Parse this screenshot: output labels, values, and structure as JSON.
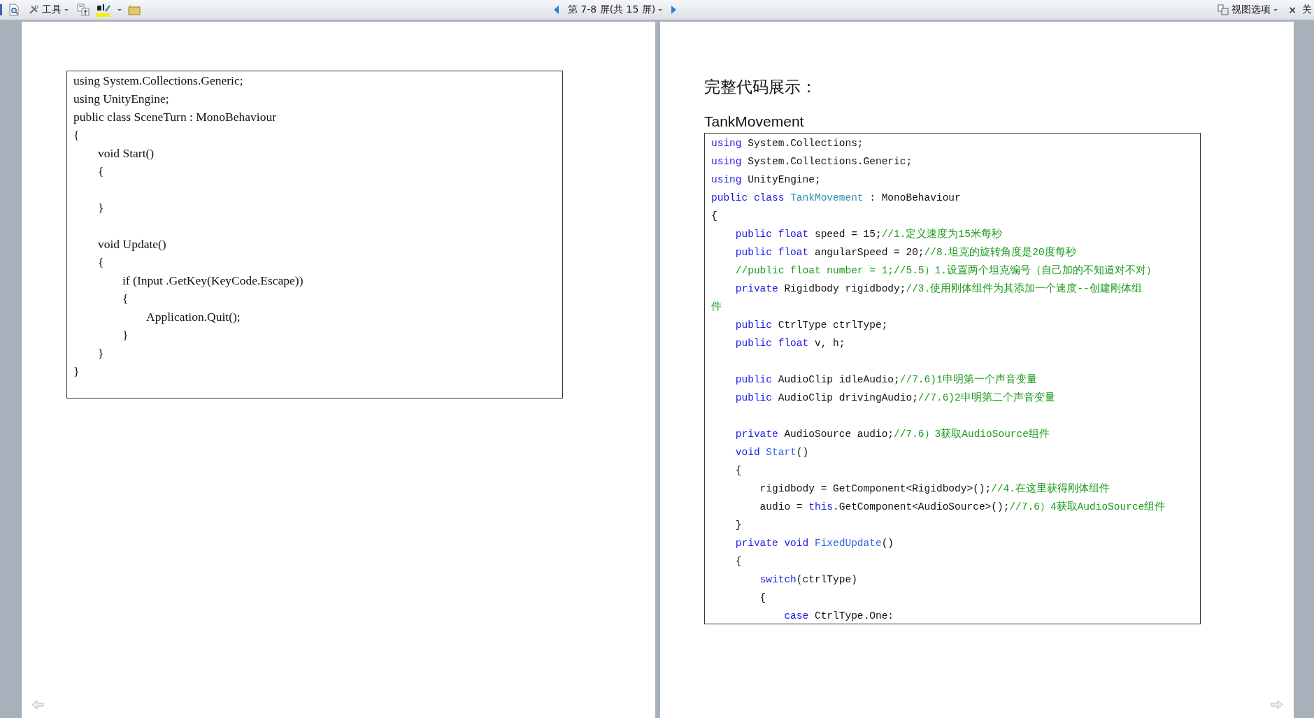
{
  "toolbar": {
    "tools_menu": {
      "label": "工具"
    },
    "page_indicator": {
      "label": "第 7-8 屏(共 15 屏)"
    },
    "view_options": {
      "label": "视图选项"
    },
    "close": {
      "symbol": "×",
      "label": "关"
    }
  },
  "pages": [
    {
      "code": {
        "kind": "plain",
        "lines": [
          {
            "text": "using System.Collections.Generic;"
          },
          {
            "text": "using UnityEngine;"
          },
          {
            "text": "public class SceneTurn : MonoBehaviour"
          },
          {
            "text": "{"
          },
          {
            "text": "        void Start()"
          },
          {
            "text": "        {"
          },
          {
            "kind": "blank"
          },
          {
            "text": "        }"
          },
          {
            "kind": "blank"
          },
          {
            "text": "        void Update()"
          },
          {
            "text": "        {"
          },
          {
            "text": "                if (Input .GetKey(KeyCode.Escape))"
          },
          {
            "text": "                {"
          },
          {
            "text": "                        Application.Quit();"
          },
          {
            "text": "                }"
          },
          {
            "text": "        }"
          },
          {
            "text": "}"
          }
        ]
      }
    },
    {
      "heading": "完整代码展示：",
      "subheading": "TankMovement",
      "code": {
        "kind": "highlighted",
        "lines": [
          {
            "tokens": [
              {
                "text": "using",
                "kind": "keyword"
              },
              {
                "text": " System.Collections;",
                "kind": "plain"
              }
            ]
          },
          {
            "tokens": [
              {
                "text": "using",
                "kind": "keyword"
              },
              {
                "text": " System.Collections.Generic;",
                "kind": "plain"
              }
            ]
          },
          {
            "tokens": [
              {
                "text": "using",
                "kind": "keyword"
              },
              {
                "text": " UnityEngine;",
                "kind": "plain"
              }
            ]
          },
          {
            "tokens": [
              {
                "text": "public class ",
                "kind": "keyword"
              },
              {
                "text": "TankMovement",
                "kind": "type"
              },
              {
                "text": " : MonoBehaviour",
                "kind": "plain"
              }
            ]
          },
          {
            "tokens": [
              {
                "text": "{",
                "kind": "plain"
              }
            ]
          },
          {
            "tokens": [
              {
                "text": "    public float",
                "kind": "keyword"
              },
              {
                "text": " speed = 15;",
                "kind": "plain"
              },
              {
                "text": "//1.定义速度为15米每秒",
                "kind": "comment"
              }
            ]
          },
          {
            "tokens": [
              {
                "text": "    public float",
                "kind": "keyword"
              },
              {
                "text": " angularSpeed = 20;",
                "kind": "plain"
              },
              {
                "text": "//8.坦克的旋转角度是20度每秒",
                "kind": "comment"
              }
            ]
          },
          {
            "tokens": [
              {
                "text": "    //public float number = 1;//5.5）1.设置两个坦克编号（自己加的不知道对不对）",
                "kind": "comment"
              }
            ]
          },
          {
            "tokens": [
              {
                "text": "    private",
                "kind": "keyword"
              },
              {
                "text": " Rigidbody rigidbody;",
                "kind": "plain"
              },
              {
                "text": "//3.使用刚体组件为其添加一个速度--创建刚体组",
                "kind": "comment"
              }
            ]
          },
          {
            "tokens": [
              {
                "text": "件",
                "kind": "comment"
              }
            ]
          },
          {
            "tokens": [
              {
                "text": "    public",
                "kind": "keyword"
              },
              {
                "text": " CtrlType ctrlType;",
                "kind": "plain"
              }
            ]
          },
          {
            "tokens": [
              {
                "text": "    public float",
                "kind": "keyword"
              },
              {
                "text": " v, h;",
                "kind": "plain"
              }
            ]
          },
          {
            "kind": "blank"
          },
          {
            "tokens": [
              {
                "text": "    public",
                "kind": "keyword"
              },
              {
                "text": " AudioClip idleAudio;",
                "kind": "plain"
              },
              {
                "text": "//7.6)1申明第一个声音变量",
                "kind": "comment"
              }
            ]
          },
          {
            "tokens": [
              {
                "text": "    public",
                "kind": "keyword"
              },
              {
                "text": " AudioClip drivingAudio;",
                "kind": "plain"
              },
              {
                "text": "//7.6)2申明第二个声音变量",
                "kind": "comment"
              }
            ]
          },
          {
            "kind": "blank"
          },
          {
            "tokens": [
              {
                "text": "    private",
                "kind": "keyword"
              },
              {
                "text": " AudioSource audio;",
                "kind": "plain"
              },
              {
                "text": "//7.6）3获取AudioSource组件",
                "kind": "comment"
              }
            ]
          },
          {
            "tokens": [
              {
                "text": "    void",
                "kind": "keyword"
              },
              {
                "text": " Start",
                "kind": "method"
              },
              {
                "text": "()",
                "kind": "plain"
              }
            ]
          },
          {
            "tokens": [
              {
                "text": "    {",
                "kind": "plain"
              }
            ]
          },
          {
            "tokens": [
              {
                "text": "        rigidbody = GetComponent<Rigidbody>();",
                "kind": "plain"
              },
              {
                "text": "//4.在这里获得刚体组件",
                "kind": "comment"
              }
            ]
          },
          {
            "tokens": [
              {
                "text": "        audio = ",
                "kind": "plain"
              },
              {
                "text": "this",
                "kind": "keyword"
              },
              {
                "text": ".GetComponent<AudioSource>();",
                "kind": "plain"
              },
              {
                "text": "//7.6）4获取AudioSource组件",
                "kind": "comment"
              }
            ]
          },
          {
            "tokens": [
              {
                "text": "    }",
                "kind": "plain"
              }
            ]
          },
          {
            "tokens": [
              {
                "text": "    private void",
                "kind": "keyword"
              },
              {
                "text": " FixedUpdate",
                "kind": "method"
              },
              {
                "text": "()",
                "kind": "plain"
              }
            ]
          },
          {
            "tokens": [
              {
                "text": "    {",
                "kind": "plain"
              }
            ]
          },
          {
            "tokens": [
              {
                "text": "        switch",
                "kind": "keyword"
              },
              {
                "text": "(ctrlType)",
                "kind": "plain"
              }
            ]
          },
          {
            "tokens": [
              {
                "text": "        {",
                "kind": "plain"
              }
            ]
          },
          {
            "tokens": [
              {
                "text": "            case",
                "kind": "keyword"
              },
              {
                "text": " CtrlType.One:",
                "kind": "plain"
              }
            ]
          }
        ]
      }
    }
  ]
}
